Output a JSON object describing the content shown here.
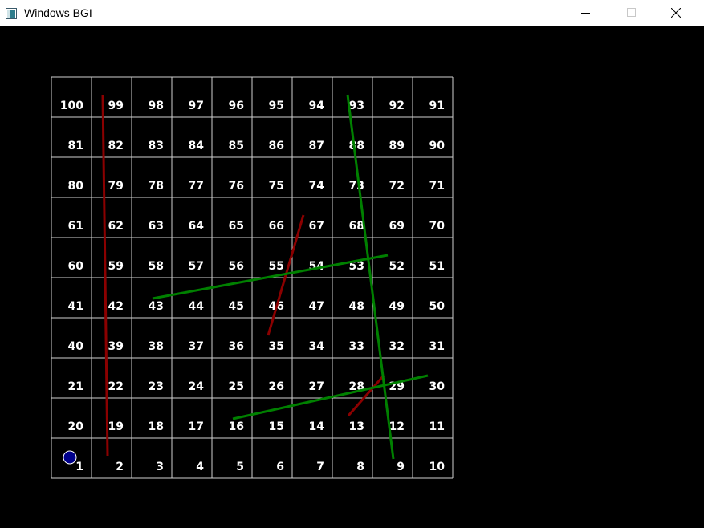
{
  "window": {
    "title": "Windows BGI",
    "icon": "bgi-window-icon",
    "controls": [
      "minimize-icon",
      "maximize-icon",
      "close-icon"
    ]
  },
  "board": {
    "rows": [
      [
        "100",
        "99",
        "98",
        "97",
        "96",
        "95",
        "94",
        "93",
        "92",
        "91"
      ],
      [
        "81",
        "82",
        "83",
        "84",
        "85",
        "86",
        "87",
        "88",
        "89",
        "90"
      ],
      [
        "80",
        "79",
        "78",
        "77",
        "76",
        "75",
        "74",
        "73",
        "72",
        "71"
      ],
      [
        "61",
        "62",
        "63",
        "64",
        "65",
        "66",
        "67",
        "68",
        "69",
        "70"
      ],
      [
        "60",
        "59",
        "58",
        "57",
        "56",
        "55",
        "54",
        "53",
        "52",
        "51"
      ],
      [
        "41",
        "42",
        "43",
        "44",
        "45",
        "46",
        "47",
        "48",
        "49",
        "50"
      ],
      [
        "40",
        "39",
        "38",
        "37",
        "36",
        "35",
        "34",
        "33",
        "32",
        "31"
      ],
      [
        "21",
        "22",
        "23",
        "24",
        "25",
        "26",
        "27",
        "28",
        "29",
        "30"
      ],
      [
        "20",
        "19",
        "18",
        "17",
        "16",
        "15",
        "14",
        "13",
        "12",
        "11"
      ],
      [
        "1",
        "2",
        "3",
        "4",
        "5",
        "6",
        "7",
        "8",
        "9",
        "10"
      ]
    ],
    "snakes": [
      {
        "from": 99,
        "to": 2
      },
      {
        "from": 67,
        "to": 35
      },
      {
        "from": 29,
        "to": 13
      }
    ],
    "ladders": [
      {
        "from": 9,
        "to": 93
      },
      {
        "from": 43,
        "to": 52
      },
      {
        "from": 16,
        "to": 30
      }
    ],
    "player_position": 1,
    "colors": {
      "grid": "#d0d0d0",
      "numbers": "#ffffff",
      "snake": "#8b0000",
      "ladder": "#008000",
      "player": "#00008b",
      "background": "#000000"
    }
  }
}
